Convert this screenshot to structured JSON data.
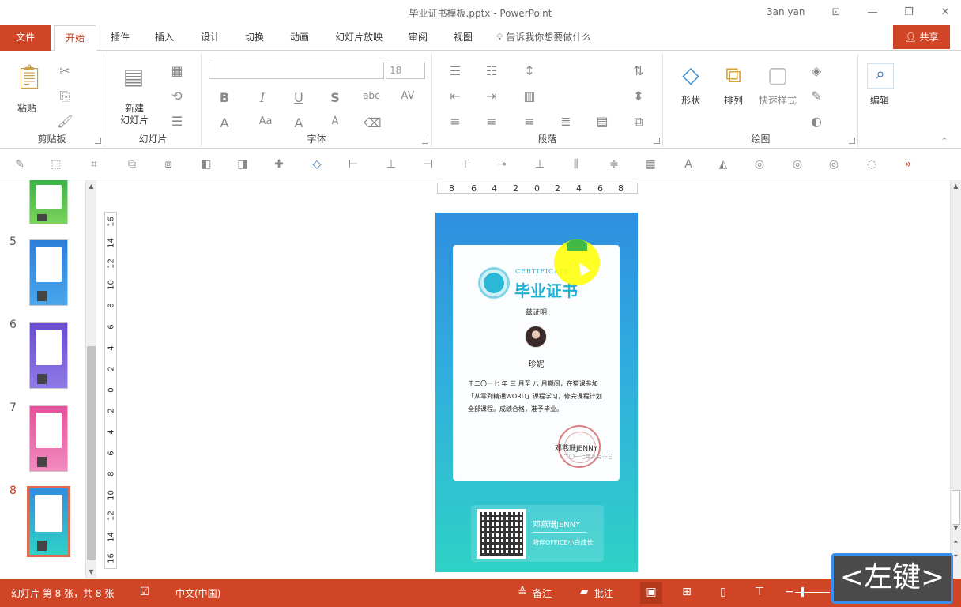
{
  "window": {
    "title": "毕业证书模板.pptx  -  PowerPoint",
    "user": "3an yan",
    "controls": [
      "⊡",
      "—",
      "❐",
      "✕"
    ]
  },
  "tabs": [
    {
      "label": "文件"
    },
    {
      "label": "开始"
    },
    {
      "label": "插件"
    },
    {
      "label": "插入"
    },
    {
      "label": "设计"
    },
    {
      "label": "切换"
    },
    {
      "label": "动画"
    },
    {
      "label": "幻灯片放映"
    },
    {
      "label": "审阅"
    },
    {
      "label": "视图"
    }
  ],
  "tell_me": "告诉我你想要做什么",
  "share": "共享",
  "ribbon": {
    "clipboard": {
      "label": "剪贴板",
      "paste": "粘贴"
    },
    "slides": {
      "label": "幻灯片",
      "new_slide_line1": "新建",
      "new_slide_line2": "幻灯片"
    },
    "font": {
      "label": "字体",
      "font_name": "",
      "font_size": "18"
    },
    "paragraph": {
      "label": "段落"
    },
    "drawing": {
      "label": "绘图",
      "shapes": "形状",
      "arrange": "排列",
      "quick_styles": "快速样式"
    },
    "editing": {
      "edit": "编辑"
    }
  },
  "thumbnails": [
    {
      "num": "",
      "color1": "#3fb04a",
      "color2": "#7bd35c"
    },
    {
      "num": "5",
      "color1": "#2b7fd9",
      "color2": "#49a7ec"
    },
    {
      "num": "6",
      "color1": "#6a4bd0",
      "color2": "#8f7ae6"
    },
    {
      "num": "7",
      "color1": "#e4509a",
      "color2": "#f28bbf"
    },
    {
      "num": "8",
      "color1": "#2f8fe0",
      "color2": "#2fd1c7"
    }
  ],
  "ruler": {
    "horizontal": [
      "8",
      "6",
      "4",
      "2",
      "0",
      "2",
      "4",
      "6",
      "8"
    ],
    "vertical": [
      "16",
      "14",
      "12",
      "10",
      "8",
      "6",
      "4",
      "2",
      "0",
      "2",
      "4",
      "6",
      "8",
      "10",
      "12",
      "14",
      "16"
    ]
  },
  "slide": {
    "cert_en": "CERTIFICATE",
    "cert_zh": "毕业证书",
    "proof": "兹证明",
    "name": "珍妮",
    "body": "于二〇一七 年 三 月至 八 月期间，在猫课参加「从零到精通WORD」课程学习，修完课程计划全部课程。成绩合格，准予毕业。",
    "signer": "邓燕珊JENNY",
    "sign_date": "二〇一七年八月十日",
    "footer_name": "邓燕珊JENNY",
    "footer_tag": "陪伴OFFICE小白成长"
  },
  "status": {
    "slide_info": "幻灯片 第 8 张，共 8 张",
    "language": "中文(中国)",
    "notes": "备注",
    "comments": "批注"
  },
  "key_badge": "<左键>",
  "colors": {
    "accent": "#d04525",
    "selected_thumb": "#e3694c"
  }
}
